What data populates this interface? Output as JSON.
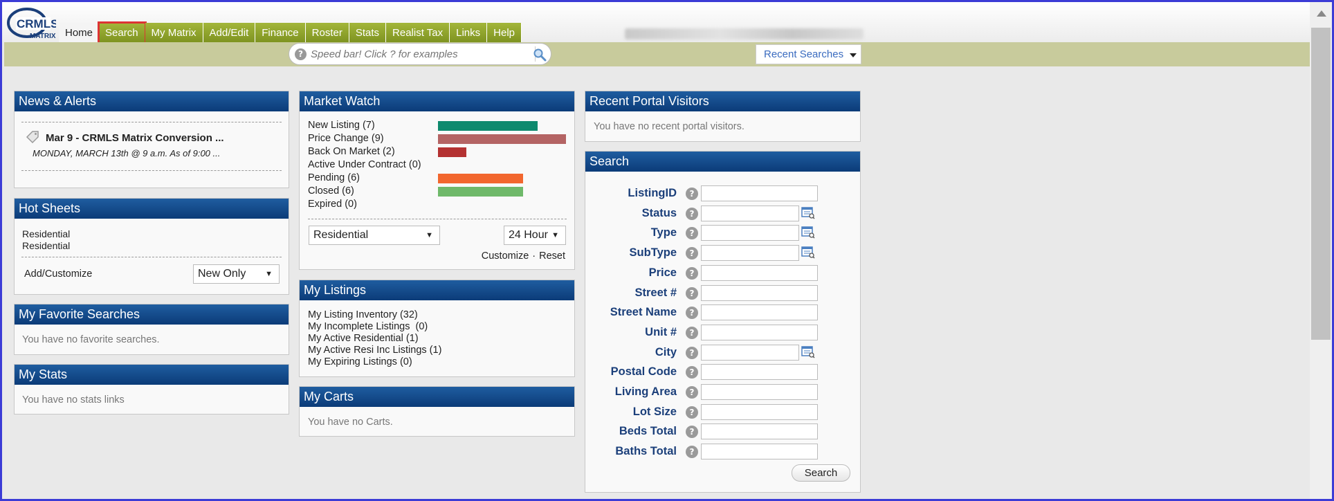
{
  "nav": {
    "logo_text_top": "CRMLS",
    "logo_text_bottom": "MATRIX",
    "items": [
      "Home",
      "Search",
      "My Matrix",
      "Add/Edit",
      "Finance",
      "Roster",
      "Stats",
      "Realist Tax",
      "Links",
      "Help"
    ],
    "selected": "Search"
  },
  "speedbar": {
    "placeholder": "Speed bar! Click ? for examples",
    "help_glyph": "?",
    "recent_searches": "Recent Searches"
  },
  "news": {
    "title": "News & Alerts",
    "item_title": "Mar 9 - CRMLS Matrix Conversion ...",
    "item_sub": "MONDAY, MARCH 13th @ 9 a.m. As of 9:00 ..."
  },
  "hot_sheets": {
    "title": "Hot Sheets",
    "items": [
      "Residential",
      "Residential"
    ],
    "add_customize": "Add/Customize",
    "filter": "New Only"
  },
  "fav_searches": {
    "title": "My Favorite Searches",
    "empty": "You have no favorite searches."
  },
  "stats": {
    "title": "My Stats",
    "empty": "You have no stats links"
  },
  "market_watch": {
    "title": "Market Watch",
    "rows": [
      {
        "label": "New Listing (7)",
        "count": 7,
        "color": "#0e8a6e"
      },
      {
        "label": "Price Change (9)",
        "count": 9,
        "color": "#b46464"
      },
      {
        "label": "Back On Market (2)",
        "count": 2,
        "color": "#b43232"
      },
      {
        "label": "Active Under Contract (0)",
        "count": 0,
        "color": "#888888"
      },
      {
        "label": "Pending (6)",
        "count": 6,
        "color": "#f2672e"
      },
      {
        "label": "Closed (6)",
        "count": 6,
        "color": "#6fb96a"
      },
      {
        "label": "Expired (0)",
        "count": 0,
        "color": "#888888"
      }
    ],
    "property_type": "Residential",
    "time_range": "24 Hour",
    "customize": "Customize",
    "separator": "·",
    "reset": "Reset"
  },
  "my_listings": {
    "title": "My Listings",
    "items": [
      "My Listing Inventory (32)",
      "My Incomplete Listings  (0)",
      "My Active Residential (1)",
      "My Active Resi Inc Listings (1)",
      "My Expiring Listings (0)"
    ]
  },
  "carts": {
    "title": "My Carts",
    "empty": "You have no Carts."
  },
  "portal_visitors": {
    "title": "Recent Portal Visitors",
    "empty": "You have no recent portal visitors."
  },
  "search_panel": {
    "title": "Search",
    "fields": [
      {
        "label": "ListingID",
        "lookup": false
      },
      {
        "label": "Status",
        "lookup": true
      },
      {
        "label": "Type",
        "lookup": true
      },
      {
        "label": "SubType",
        "lookup": true
      },
      {
        "label": "Price",
        "lookup": false
      },
      {
        "label": "Street #",
        "lookup": false
      },
      {
        "label": "Street Name",
        "lookup": false
      },
      {
        "label": "Unit #",
        "lookup": false
      },
      {
        "label": "City",
        "lookup": true
      },
      {
        "label": "Postal Code",
        "lookup": false
      },
      {
        "label": "Living Area",
        "lookup": false
      },
      {
        "label": "Lot Size",
        "lookup": false
      },
      {
        "label": "Beds Total",
        "lookup": false
      },
      {
        "label": "Baths Total",
        "lookup": false
      }
    ],
    "button": "Search",
    "help_glyph": "?"
  }
}
